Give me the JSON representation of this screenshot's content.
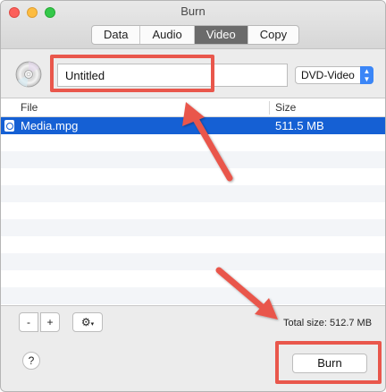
{
  "window": {
    "title": "Burn"
  },
  "tabs": [
    {
      "label": "Data",
      "active": false
    },
    {
      "label": "Audio",
      "active": false
    },
    {
      "label": "Video",
      "active": true
    },
    {
      "label": "Copy",
      "active": false
    }
  ],
  "toolbar": {
    "disc_name_value": "Untitled",
    "disc_type_selected": "DVD-Video",
    "disc_icon": "cd-disc-icon"
  },
  "table": {
    "columns": [
      "File",
      "Size"
    ],
    "rows": [
      {
        "file": "Media.mpg",
        "size": "511.5 MB",
        "selected": true
      }
    ]
  },
  "bottom": {
    "minus_label": "-",
    "plus_label": "+",
    "gear_icon": "gear-icon",
    "total_size": "Total size: 512.7 MB",
    "help_label": "?",
    "burn_label": "Burn"
  },
  "colors": {
    "selection": "#1560d4",
    "annotation": "#e9574c",
    "active_tab": "#6b6b6b"
  }
}
